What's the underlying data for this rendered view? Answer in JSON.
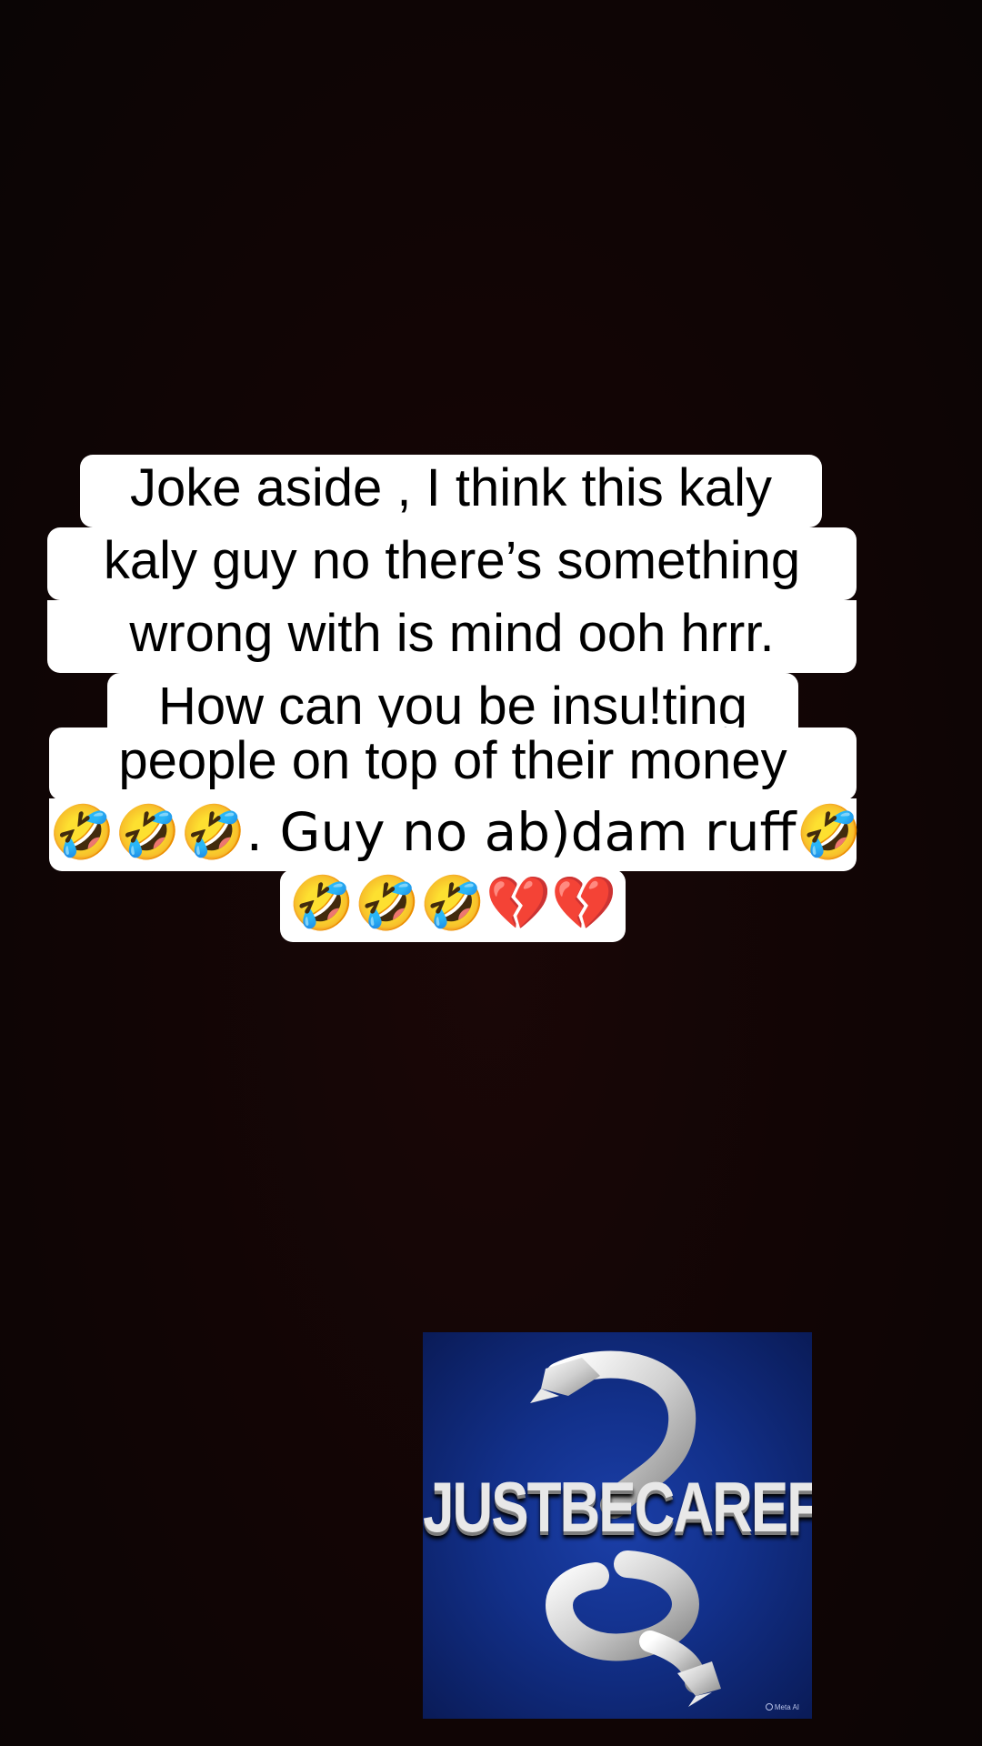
{
  "caption": {
    "lines": [
      "Joke aside , I think this kaly",
      "kaly guy no there’s something",
      "wrong with is mind ooh hrrr.",
      "How can you be insu!ting",
      "people on top of their money",
      "🤣🤣🤣. Guy no ab)dam ruff🤣",
      "🤣🤣🤣💔💔"
    ]
  },
  "logo": {
    "text": "JUSTBECAREFUL",
    "watermark": "Meta AI",
    "colors": {
      "background": "#12308a",
      "serpent": "#d9d9d9"
    }
  },
  "colors": {
    "background": "#120505",
    "bubble": "#ffffff",
    "text": "#000000"
  }
}
